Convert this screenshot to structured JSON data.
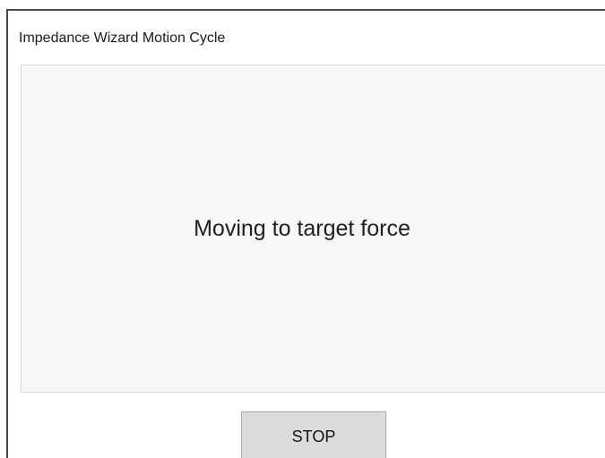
{
  "window": {
    "title": "Impedance Wizard Motion Cycle"
  },
  "status": {
    "message": "Moving to target force"
  },
  "controls": {
    "stop_label": "STOP"
  }
}
